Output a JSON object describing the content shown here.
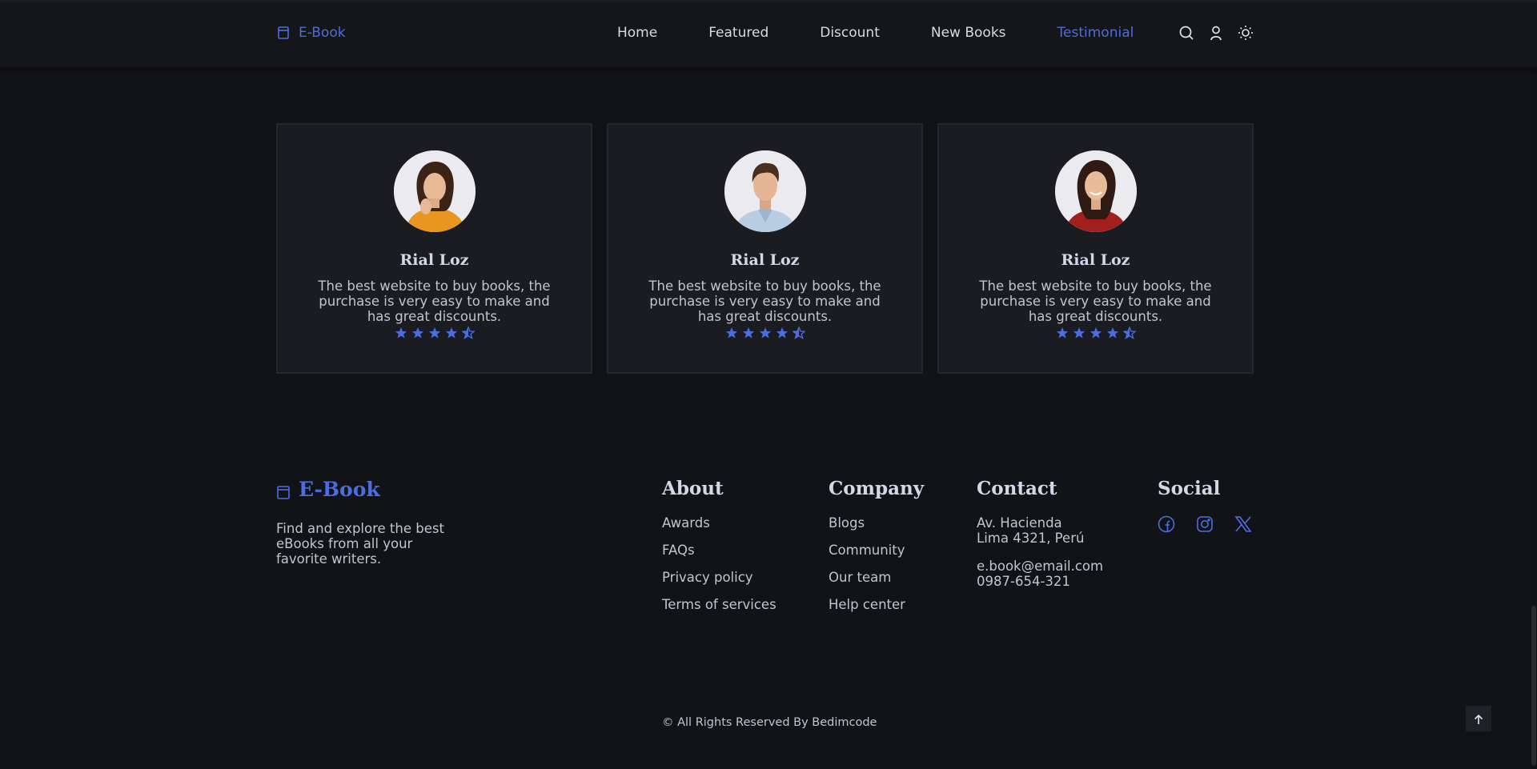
{
  "header": {
    "logo_text": "E-Book",
    "nav": [
      {
        "label": "Home",
        "active": false
      },
      {
        "label": "Featured",
        "active": false
      },
      {
        "label": "Discount",
        "active": false
      },
      {
        "label": "New Books",
        "active": false
      },
      {
        "label": "Testimonial",
        "active": true
      }
    ],
    "icons": [
      "search-icon",
      "user-icon",
      "sun-icon"
    ]
  },
  "testimonials": [
    {
      "name": "Rial Loz",
      "text": "The best website to buy books, the purchase is very easy to make and has great discounts.",
      "rating": 4.5,
      "avatar": "woman-thinking-portrait"
    },
    {
      "name": "Rial Loz",
      "text": "The best website to buy books, the purchase is very easy to make and has great discounts.",
      "rating": 4.5,
      "avatar": "man-smiling-portrait"
    },
    {
      "name": "Rial Loz",
      "text": "The best website to buy books, the purchase is very easy to make and has great discounts.",
      "rating": 4.5,
      "avatar": "woman-smiling-portrait"
    }
  ],
  "footer": {
    "logo_text": "E-Book",
    "description": "Find and explore the best eBooks from all your favorite writers.",
    "about": {
      "title": "About",
      "links": [
        "Awards",
        "FAQs",
        "Privacy policy",
        "Terms of services"
      ]
    },
    "company": {
      "title": "Company",
      "links": [
        "Blogs",
        "Community",
        "Our team",
        "Help center"
      ]
    },
    "contact": {
      "title": "Contact",
      "address_line1": "Av. Hacienda",
      "address_line2": "Lima 4321, Perú",
      "email": "e.book@email.com",
      "phone": "0987-654-321"
    },
    "social": {
      "title": "Social",
      "icons": [
        "facebook-icon",
        "instagram-icon",
        "x-icon"
      ]
    },
    "copyright": "© All Rights Reserved By Bedimcode"
  },
  "colors": {
    "accent": "#4a6ee0",
    "background": "#121317",
    "card": "#1b1c21",
    "star": "#4a6ee0"
  }
}
